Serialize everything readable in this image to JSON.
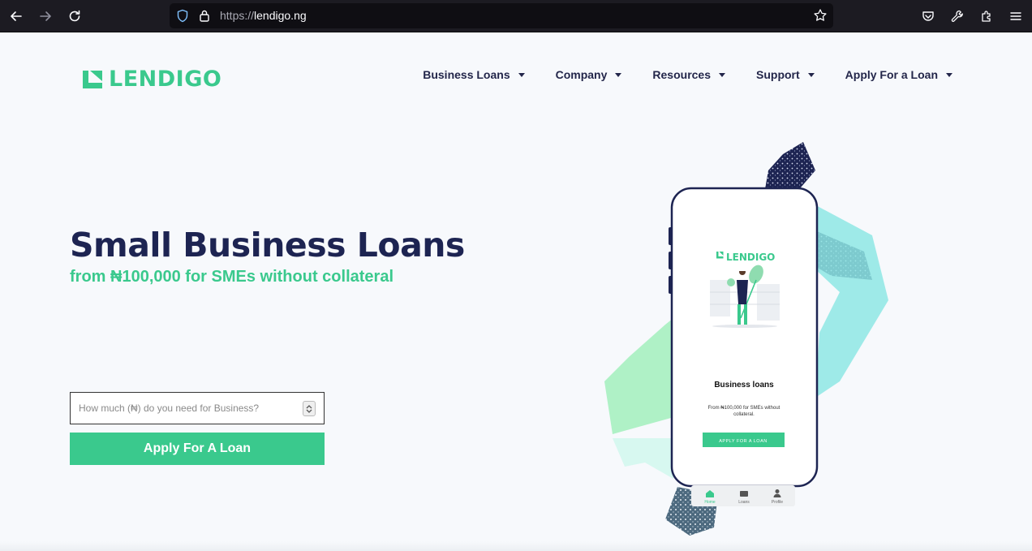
{
  "browser": {
    "url_scheme": "https://",
    "url_host": "lendigo.ng"
  },
  "header": {
    "logo_text": "LENDIGO",
    "nav": [
      {
        "label": "Business Loans"
      },
      {
        "label": "Company"
      },
      {
        "label": "Resources"
      },
      {
        "label": "Support"
      },
      {
        "label": "Apply For a Loan"
      }
    ]
  },
  "hero": {
    "title": "Small Business Loans",
    "subtitle": "from ₦100,000 for SMEs without collateral",
    "input_placeholder": "How much (₦) do you need for Business?",
    "button_label": "Apply For A Loan"
  },
  "phone": {
    "logo_text": "LENDIGO",
    "title": "Business loans",
    "desc_line1": "From ₦100,000 for SMEs without",
    "desc_line2": "collateral.",
    "button_label": "APPLY FOR A LOAN",
    "tabs": [
      {
        "label": "Home"
      },
      {
        "label": "Loans"
      },
      {
        "label": "Profile"
      }
    ]
  },
  "colors": {
    "brand_green": "#3ac98d",
    "navy": "#1d2452",
    "mint": "#8ee8e4",
    "light_green": "#a6f0c0"
  }
}
